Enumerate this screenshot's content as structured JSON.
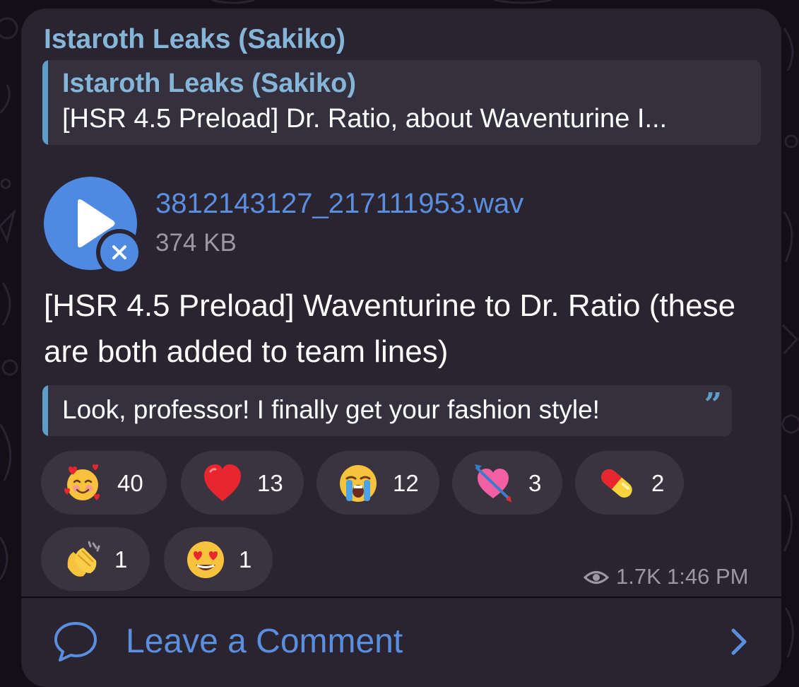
{
  "post": {
    "channel_name": "Istaroth Leaks (Sakiko)",
    "reply": {
      "title": "Istaroth Leaks (Sakiko)",
      "text": "[HSR 4.5 Preload] Dr. Ratio, about Waventurine I..."
    },
    "file": {
      "name": "3812143127_217111953.wav",
      "size": "374 KB",
      "play_icon": "play-icon",
      "cancel_icon": "close-icon"
    },
    "message_text": "[HSR 4.5 Preload] Waventurine to Dr. Ratio (these are both added to team lines)",
    "quote_text": "Look, professor! I finally get your fashion style!",
    "quote_mark": "”",
    "reactions": [
      {
        "emoji": "smiling-face-with-hearts",
        "count": "40"
      },
      {
        "emoji": "red-heart",
        "count": "13"
      },
      {
        "emoji": "loudly-crying-face",
        "count": "12"
      },
      {
        "emoji": "heart-with-arrow",
        "count": "3"
      },
      {
        "emoji": "pill",
        "count": "2"
      },
      {
        "emoji": "clapping-hands",
        "count": "1"
      },
      {
        "emoji": "heart-eyes-face",
        "count": "1"
      }
    ],
    "views": "1.7K",
    "time": "1:46 PM"
  },
  "comments": {
    "label": "Leave a Comment",
    "icon": "speech-bubble-icon",
    "chevron": "chevron-right-icon"
  },
  "colors": {
    "background": "#140f16",
    "bubble": "#2a2330",
    "accent_blue": "#5a8fe0",
    "channel_name": "#85b6d8",
    "quote_bar": "#5e9ec7",
    "reaction_pill": "#3a3340",
    "muted_text": "#9d97a3"
  }
}
